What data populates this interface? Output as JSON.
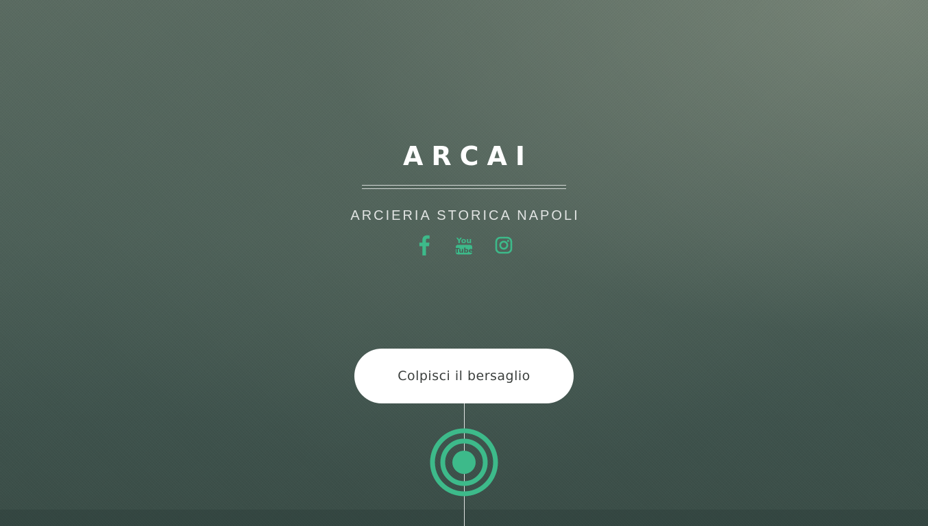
{
  "header": {
    "title": "ARCAI",
    "subtitle": "ARCIERIA STORICA NAPOLI"
  },
  "social": [
    {
      "name": "facebook",
      "icon": "facebook-icon"
    },
    {
      "name": "youtube",
      "icon": "youtube-icon"
    },
    {
      "name": "instagram",
      "icon": "instagram-icon"
    }
  ],
  "youtube_icon_text": {
    "top": "You",
    "bottom": "Tube"
  },
  "cta": {
    "label": "Colpisci il bersaglio"
  },
  "scroll_target": {
    "icon": "target-icon"
  },
  "colors": {
    "accent": "#3dba8a",
    "title": "#ffffff",
    "button_bg": "#ffffff",
    "button_text": "#3b3f3d"
  }
}
